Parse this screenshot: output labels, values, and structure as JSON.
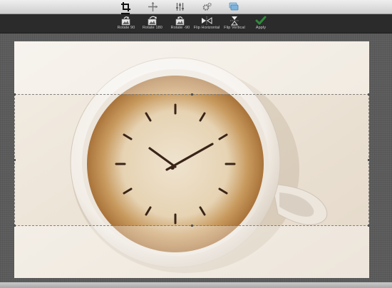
{
  "top_tabs": [
    {
      "name": "crop-tab",
      "icon": "crop-icon",
      "active": true
    },
    {
      "name": "transform-tab",
      "icon": "move-icon",
      "active": false
    },
    {
      "name": "adjust-tab",
      "icon": "sliders-icon",
      "active": false
    },
    {
      "name": "effects-tab",
      "icon": "gears-icon",
      "active": false
    },
    {
      "name": "overlay-tab",
      "icon": "layers-icon",
      "active": false
    }
  ],
  "toolbar": {
    "rotate_90": "Rotate 90",
    "rotate_180": "Rotate 180",
    "rotate_minus_90": "Rotate -90",
    "flip_horizontal": "Flip Horizontal",
    "flip_vertical": "Flip Vertical",
    "apply": "Apply"
  },
  "colors": {
    "toolbar_bg": "#2b2b2b",
    "apply_green": "#2e8b3a",
    "canvas_bg": "#5b5b5b"
  }
}
